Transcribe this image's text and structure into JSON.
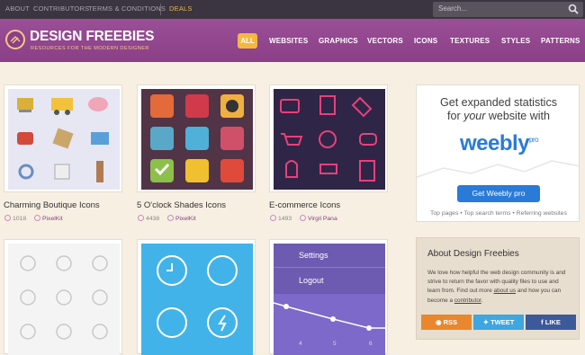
{
  "topbar": {
    "links": [
      "ABOUT",
      "CONTRIBUTORS",
      "TERMS & CONDITIONS"
    ],
    "deals": "DEALS",
    "search_placeholder": "Search..."
  },
  "header": {
    "title": "DESIGN FREEBIES",
    "subtitle": "RESOURCES FOR THE MODERN DESIGNER",
    "nav": [
      "ALL",
      "WEBSITES",
      "GRAPHICS",
      "VECTORS",
      "ICONS",
      "TEXTURES",
      "STYLES",
      "PATTERNS"
    ]
  },
  "cards": [
    {
      "title": "Charming Boutique Icons",
      "count": "1018",
      "author": "PixelKit"
    },
    {
      "title": "5 O'clock Shades Icons",
      "count": "4438",
      "author": "PixelKit"
    },
    {
      "title": "E-commerce Icons",
      "count": "1493",
      "author": "Virgil Pana"
    }
  ],
  "card_row2": {
    "settings": "Settings",
    "logout": "Logout",
    "chart_labels": [
      "4",
      "5",
      "6"
    ]
  },
  "ad": {
    "line1": "Get expanded statistics",
    "line2_a": "for ",
    "line2_em": "your",
    "line2_b": " website with",
    "brand": "weebly",
    "brand_sup": "pro",
    "button": "Get Weebly pro",
    "footer": "Top pages  •  Top search terms  •  Referring websites"
  },
  "about": {
    "title": "About Design Freebies",
    "body_a": "We love how helpful the web design community is and strive to return the favor with quality files to use and learn from. Find out more ",
    "link1": "about us",
    "body_b": " and how you can become a ",
    "link2": "contributor",
    "body_c": ".",
    "rss": "RSS",
    "tweet": "TWEET",
    "like": "LIKE"
  }
}
